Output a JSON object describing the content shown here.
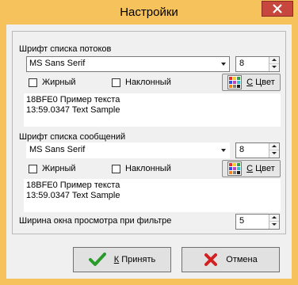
{
  "window": {
    "title": "Настройки",
    "frame_color": "#f6c25c",
    "close_color": "#c7463d"
  },
  "thread_font": {
    "label": "Шрифт списка потоков",
    "font_value": "MS Sans Serif",
    "size_value": "8",
    "bold_label": "Жирный",
    "italic_label": "Наклонный",
    "color_button_accel": "С",
    "color_button_rest": " Цвет",
    "sample_line1": "18BFE0 Пример текста",
    "sample_line2": "13:59.0347 Text Sample"
  },
  "message_font": {
    "label": "Шрифт списка сообщений",
    "font_value": "MS Sans Serif",
    "size_value": "8",
    "bold_label": "Жирный",
    "italic_label": "Наклонный",
    "color_button_accel": "С",
    "color_button_rest": " Цвет",
    "sample_line1": "18BFE0 Пример текста",
    "sample_line2": "13:59.0347 Text Sample"
  },
  "filter": {
    "label": "Ширина окна просмотра при фильтре",
    "value": "5"
  },
  "buttons": {
    "ok_accel": "К",
    "ok_rest": " Принять",
    "cancel_label": "Отмена"
  },
  "icons": {
    "ok": "green-check-icon",
    "cancel": "red-x-icon",
    "color": "color-palette-icon"
  }
}
